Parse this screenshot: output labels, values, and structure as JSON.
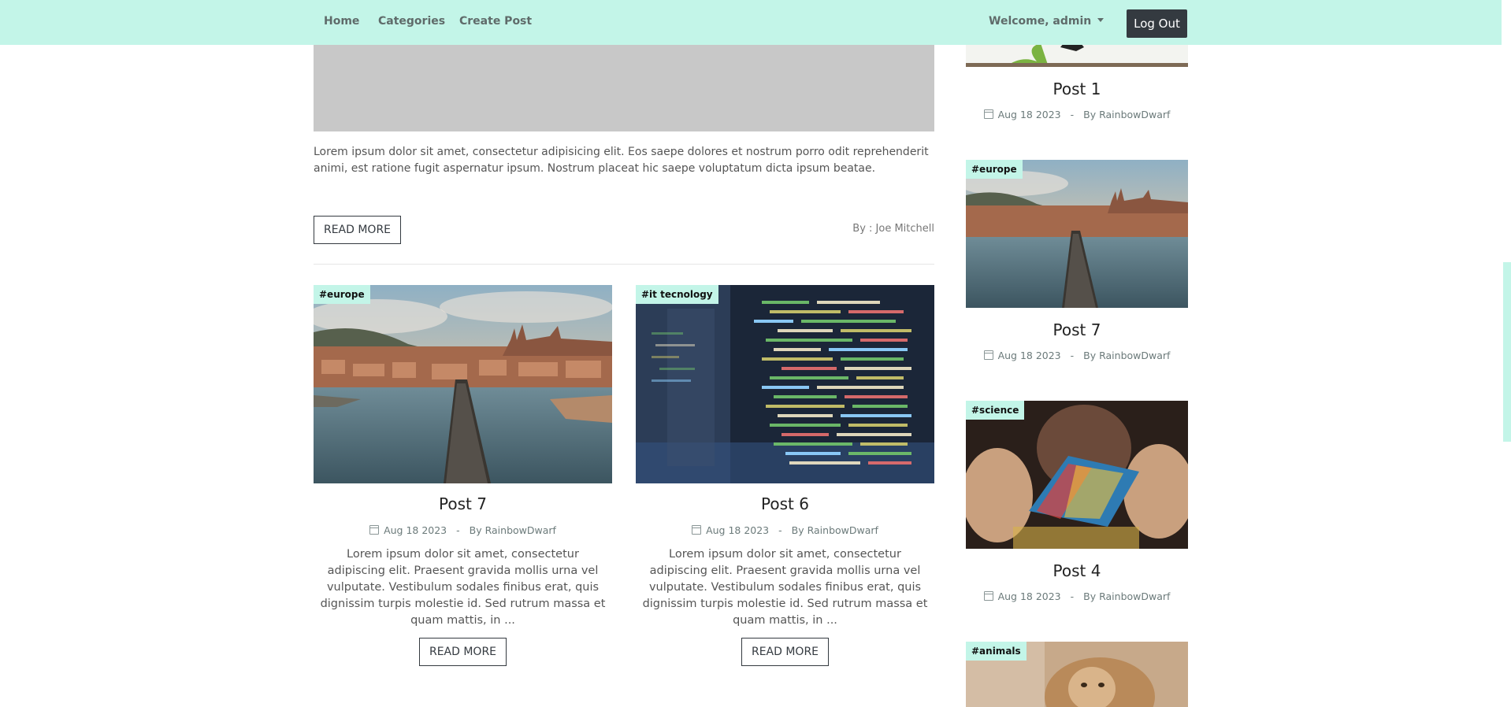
{
  "nav": {
    "home": "Home",
    "categories": "Categories",
    "create_post": "Create Post",
    "welcome": "Welcome, admin",
    "logout": "Log Out"
  },
  "featured": {
    "excerpt": "Lorem ipsum dolor sit amet, consectetur adipisicing elit. Eos saepe dolores et nostrum porro odit reprehenderit animi, est ratione fugit aspernatur ipsum. Nostrum placeat hic saepe voluptatum dicta ipsum beatae.",
    "read_more": "READ MORE",
    "author": "By : Joe Mitchell"
  },
  "posts": [
    {
      "tag": "#europe",
      "title": "Post 7",
      "date": "Aug 18 2023",
      "sep": "-",
      "author": "By RainbowDwarf",
      "excerpt": "Lorem ipsum dolor sit amet, consectetur adipiscing elit. Praesent gravida mollis urna vel vulputate. Vestibulum sodales finibus erat, quis dignissim turpis molestie id. Sed rutrum massa et quam mattis, in ...",
      "read_more": "READ MORE"
    },
    {
      "tag": "#it tecnology",
      "title": "Post 6",
      "date": "Aug 18 2023",
      "sep": "-",
      "author": "By RainbowDwarf",
      "excerpt": "Lorem ipsum dolor sit amet, consectetur adipiscing elit. Praesent gravida mollis urna vel vulputate. Vestibulum sodales finibus erat, quis dignissim turpis molestie id. Sed rutrum massa et quam mattis, in ...",
      "read_more": "READ MORE"
    }
  ],
  "sidebar": [
    {
      "title": "Post 1",
      "date": "Aug 18 2023",
      "sep": "-",
      "author": "By RainbowDwarf"
    },
    {
      "tag": "#europe",
      "title": "Post 7",
      "date": "Aug 18 2023",
      "sep": "-",
      "author": "By RainbowDwarf"
    },
    {
      "tag": "#science",
      "title": "Post 4",
      "date": "Aug 18 2023",
      "sep": "-",
      "author": "By RainbowDwarf"
    },
    {
      "tag": "#animals"
    }
  ],
  "colors": {
    "navbar": "#c3f5e8",
    "tag_bg": "#c3f5e8",
    "logout_bg": "#343a40"
  }
}
